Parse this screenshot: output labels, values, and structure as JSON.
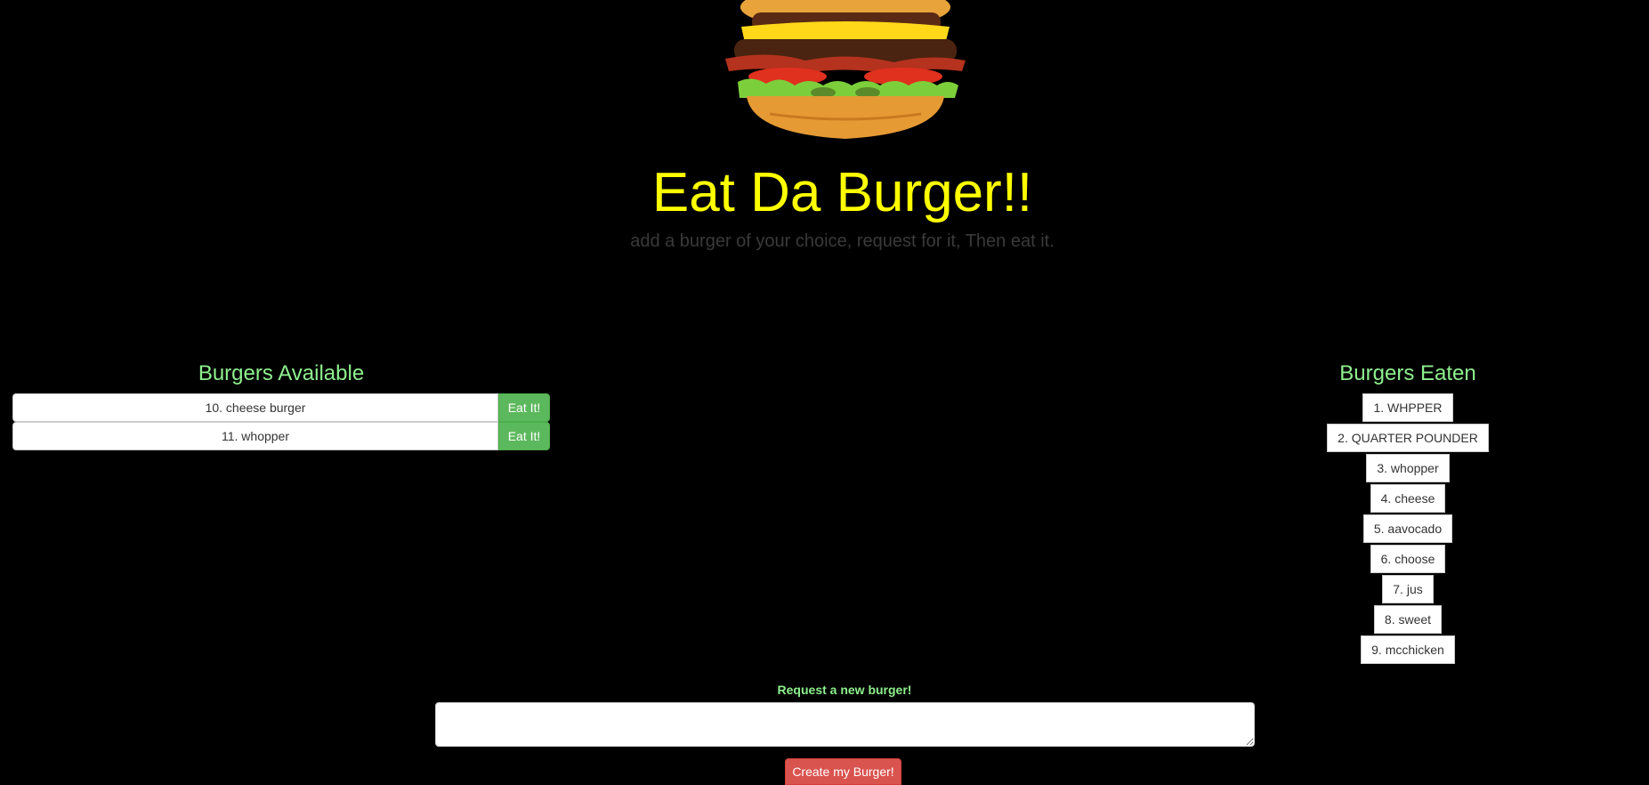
{
  "header": {
    "image_name": "burger-image",
    "title": "Eat Da Burger!!",
    "subtitle": "add a burger of your choice, request for it, Then eat it."
  },
  "available": {
    "title": "Burgers Available",
    "eat_label": "Eat It!",
    "items": [
      {
        "label": "10. cheese burger"
      },
      {
        "label": "11. whopper"
      }
    ]
  },
  "eaten": {
    "title": "Burgers Eaten",
    "items": [
      {
        "label": "1. WHPPER"
      },
      {
        "label": "2. QUARTER POUNDER"
      },
      {
        "label": "3. whopper"
      },
      {
        "label": "4. cheese"
      },
      {
        "label": "5. aavocado"
      },
      {
        "label": "6. choose"
      },
      {
        "label": "7. jus"
      },
      {
        "label": "8. sweet"
      },
      {
        "label": "9. mcchicken"
      }
    ]
  },
  "request": {
    "label": "Request a new burger!",
    "input_value": "",
    "button_label": "Create my Burger!"
  },
  "colors": {
    "background": "#000000",
    "title": "#ffff00",
    "section_titles": "#8ef08e",
    "eat_button": "#5cb85c",
    "create_button": "#d9534f"
  }
}
